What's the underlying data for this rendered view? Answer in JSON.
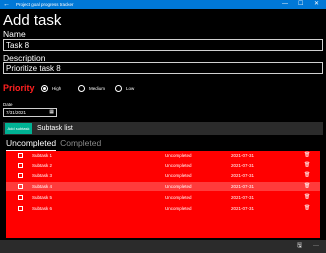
{
  "window": {
    "title": "Project goal progress tracker",
    "back_glyph": "←",
    "minimize_glyph": "—",
    "maximize_glyph": "☐",
    "close_glyph": "✕",
    "accent_color": "#0078d7"
  },
  "page": {
    "title": "Add task"
  },
  "form": {
    "name_label": "Name",
    "name_value": "Task 8",
    "description_label": "Description",
    "description_value": "Prioritize task 8"
  },
  "priority": {
    "label": "Priority",
    "label_color": "#ff2020",
    "options": [
      {
        "label": "High",
        "selected": true
      },
      {
        "label": "Medium",
        "selected": false
      },
      {
        "label": "Low",
        "selected": false
      }
    ]
  },
  "date": {
    "label": "Date",
    "value": "7/31/2021",
    "icon": "calendar-icon"
  },
  "subtasks": {
    "add_button": "Add subtask",
    "add_button_color": "#00b294",
    "title": "Subtask list",
    "tabs": [
      {
        "label": "Uncompleted",
        "active": true
      },
      {
        "label": "Completed",
        "active": false
      }
    ],
    "list_color": "#ff0000",
    "rows": [
      {
        "name": "Subtask 1",
        "status": "Uncompleted",
        "date": "2021-07-31"
      },
      {
        "name": "Subtask 2",
        "status": "Uncompleted",
        "date": "2021-07-31"
      },
      {
        "name": "Subtask 3",
        "status": "Uncompleted",
        "date": "2021-07-31"
      },
      {
        "name": "Subtask 4",
        "status": "Uncompleted",
        "date": "2021-07-31"
      },
      {
        "name": "Subtask 5",
        "status": "Uncompleted",
        "date": "2021-07-31"
      },
      {
        "name": "Subtask 6",
        "status": "Uncompleted",
        "date": "2021-07-31"
      }
    ]
  },
  "command_bar": {
    "save_icon": "save-icon",
    "more_icon": "more-icon"
  }
}
